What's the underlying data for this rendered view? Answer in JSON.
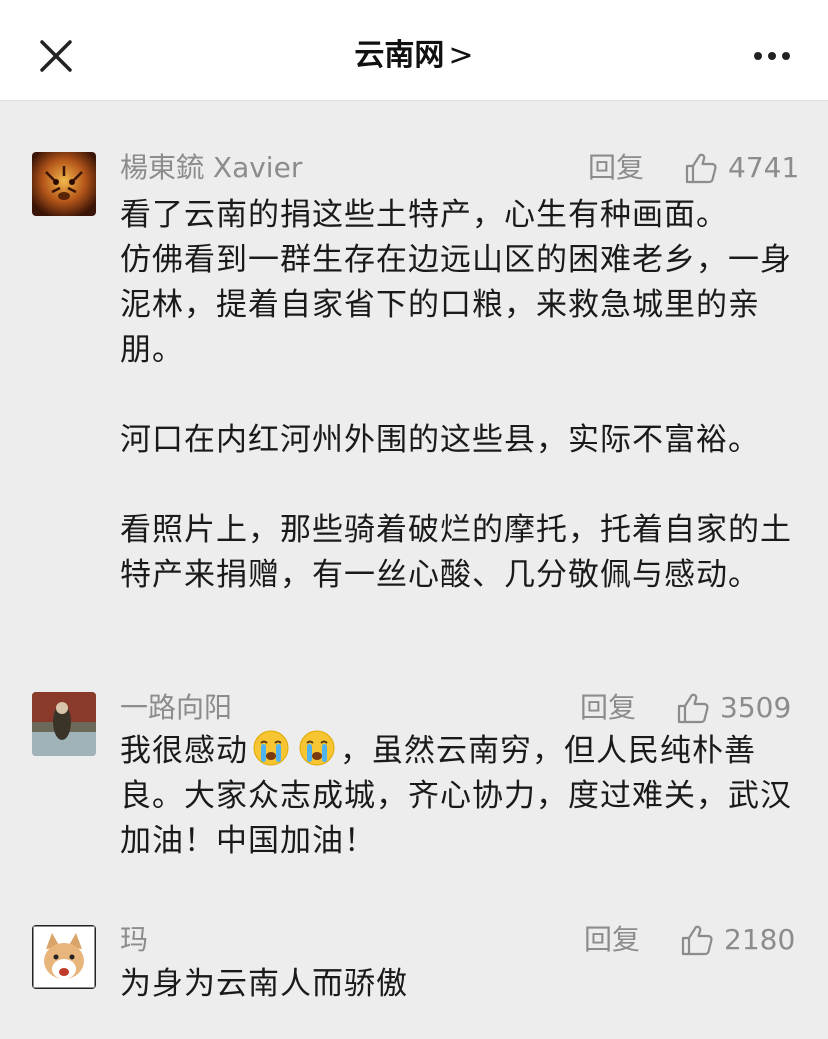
{
  "header": {
    "title": "云南网",
    "chevron": ">"
  },
  "comments": [
    {
      "username": "楊東鋶 Xavier",
      "reply_label": "回复",
      "likes": "4741",
      "paragraphs": [
        "看了云南的捐这些土特产，心生有种画面。\n仿佛看到一群生存在边远山区的困难老乡，一身泥林，提着自家省下的口粮，来救急城里的亲朋。",
        "河口在内红河州外围的这些县，实际不富裕。",
        "看照片上，那些骑着破烂的摩托，托着自家的土特产来捐赠，有一丝心酸、几分敬佩与感动。"
      ]
    },
    {
      "username": "一路向阳",
      "reply_label": "回复",
      "likes": "3509",
      "text_before_emoji": "我很感动",
      "text_after_emoji": "，虽然云南穷，但人民纯朴善良。大家众志成城，齐心协力，度过难关，武汉加油！中国加油！"
    },
    {
      "username": "玛",
      "reply_label": "回复",
      "likes": "2180",
      "text": "为身为云南人而骄傲"
    }
  ],
  "colors": {
    "background": "#ededed",
    "topbar": "#ffffff",
    "meta_text": "#8c8c8c",
    "body_text": "#1a1a1a"
  }
}
